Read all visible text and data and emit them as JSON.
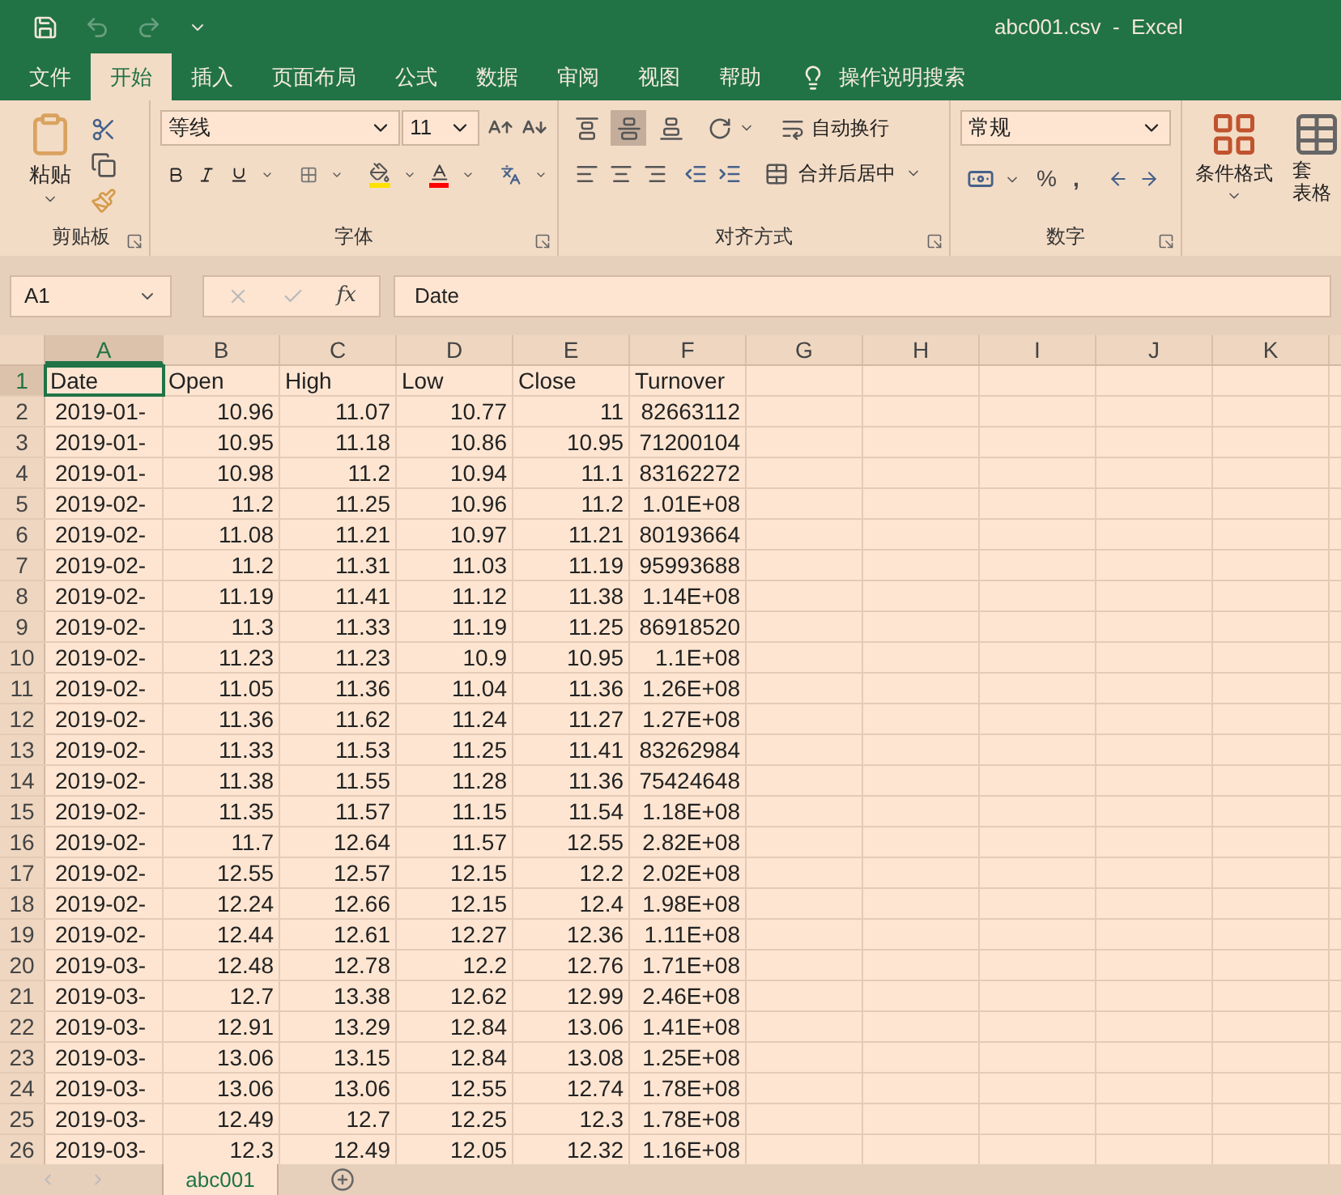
{
  "window": {
    "title": "abc001.csv  -  Excel"
  },
  "menu_tabs": [
    {
      "label": "文件",
      "selected": false
    },
    {
      "label": "开始",
      "selected": true
    },
    {
      "label": "插入",
      "selected": false
    },
    {
      "label": "页面布局",
      "selected": false
    },
    {
      "label": "公式",
      "selected": false
    },
    {
      "label": "数据",
      "selected": false
    },
    {
      "label": "审阅",
      "selected": false
    },
    {
      "label": "视图",
      "selected": false
    },
    {
      "label": "帮助",
      "selected": false
    }
  ],
  "tell_me": {
    "placeholder": "操作说明搜索"
  },
  "ribbon": {
    "clipboard": {
      "label": "剪贴板",
      "paste": "粘贴"
    },
    "font": {
      "label": "字体",
      "font_name": "等线",
      "font_size": "11"
    },
    "alignment": {
      "label": "对齐方式",
      "vertical": [
        {
          "kind": "top",
          "selected": false
        },
        {
          "kind": "middle",
          "selected": true
        },
        {
          "kind": "bottom",
          "selected": false
        }
      ],
      "wrap": "自动换行",
      "merge": "合并后居中"
    },
    "number": {
      "label": "数字",
      "format": "常规",
      "percent": "%",
      "comma": ","
    },
    "styles": {
      "conditional": "条件格式",
      "table_top": "套",
      "table_bottom": "表格"
    }
  },
  "formula_bar": {
    "name_box": "A1",
    "fx": "fx",
    "value": "Date"
  },
  "columns": [
    {
      "label": "A",
      "selected": true
    },
    {
      "label": "B",
      "selected": false
    },
    {
      "label": "C",
      "selected": false
    },
    {
      "label": "D",
      "selected": false
    },
    {
      "label": "E",
      "selected": false
    },
    {
      "label": "F",
      "selected": false
    },
    {
      "label": "G",
      "selected": false
    },
    {
      "label": "H",
      "selected": false
    },
    {
      "label": "I",
      "selected": false
    },
    {
      "label": "J",
      "selected": false
    },
    {
      "label": "K",
      "selected": false
    }
  ],
  "rows": [
    {
      "n": "1",
      "selected": true,
      "cells": [
        "Date",
        "Open",
        "High",
        "Low",
        "Close",
        "Turnover"
      ]
    },
    {
      "n": "2",
      "selected": false,
      "cells": [
        "2019-01-",
        "10.96",
        "11.07",
        "10.77",
        "11",
        "82663112"
      ]
    },
    {
      "n": "3",
      "selected": false,
      "cells": [
        "2019-01-",
        "10.95",
        "11.18",
        "10.86",
        "10.95",
        "71200104"
      ]
    },
    {
      "n": "4",
      "selected": false,
      "cells": [
        "2019-01-",
        "10.98",
        "11.2",
        "10.94",
        "11.1",
        "83162272"
      ]
    },
    {
      "n": "5",
      "selected": false,
      "cells": [
        "2019-02-",
        "11.2",
        "11.25",
        "10.96",
        "11.2",
        "1.01E+08"
      ]
    },
    {
      "n": "6",
      "selected": false,
      "cells": [
        "2019-02-",
        "11.08",
        "11.21",
        "10.97",
        "11.21",
        "80193664"
      ]
    },
    {
      "n": "7",
      "selected": false,
      "cells": [
        "2019-02-",
        "11.2",
        "11.31",
        "11.03",
        "11.19",
        "95993688"
      ]
    },
    {
      "n": "8",
      "selected": false,
      "cells": [
        "2019-02-",
        "11.19",
        "11.41",
        "11.12",
        "11.38",
        "1.14E+08"
      ]
    },
    {
      "n": "9",
      "selected": false,
      "cells": [
        "2019-02-",
        "11.3",
        "11.33",
        "11.19",
        "11.25",
        "86918520"
      ]
    },
    {
      "n": "10",
      "selected": false,
      "cells": [
        "2019-02-",
        "11.23",
        "11.23",
        "10.9",
        "10.95",
        "1.1E+08"
      ]
    },
    {
      "n": "11",
      "selected": false,
      "cells": [
        "2019-02-",
        "11.05",
        "11.36",
        "11.04",
        "11.36",
        "1.26E+08"
      ]
    },
    {
      "n": "12",
      "selected": false,
      "cells": [
        "2019-02-",
        "11.36",
        "11.62",
        "11.24",
        "11.27",
        "1.27E+08"
      ]
    },
    {
      "n": "13",
      "selected": false,
      "cells": [
        "2019-02-",
        "11.33",
        "11.53",
        "11.25",
        "11.41",
        "83262984"
      ]
    },
    {
      "n": "14",
      "selected": false,
      "cells": [
        "2019-02-",
        "11.38",
        "11.55",
        "11.28",
        "11.36",
        "75424648"
      ]
    },
    {
      "n": "15",
      "selected": false,
      "cells": [
        "2019-02-",
        "11.35",
        "11.57",
        "11.15",
        "11.54",
        "1.18E+08"
      ]
    },
    {
      "n": "16",
      "selected": false,
      "cells": [
        "2019-02-",
        "11.7",
        "12.64",
        "11.57",
        "12.55",
        "2.82E+08"
      ]
    },
    {
      "n": "17",
      "selected": false,
      "cells": [
        "2019-02-",
        "12.55",
        "12.57",
        "12.15",
        "12.2",
        "2.02E+08"
      ]
    },
    {
      "n": "18",
      "selected": false,
      "cells": [
        "2019-02-",
        "12.24",
        "12.66",
        "12.15",
        "12.4",
        "1.98E+08"
      ]
    },
    {
      "n": "19",
      "selected": false,
      "cells": [
        "2019-02-",
        "12.44",
        "12.61",
        "12.27",
        "12.36",
        "1.11E+08"
      ]
    },
    {
      "n": "20",
      "selected": false,
      "cells": [
        "2019-03-",
        "12.48",
        "12.78",
        "12.2",
        "12.76",
        "1.71E+08"
      ]
    },
    {
      "n": "21",
      "selected": false,
      "cells": [
        "2019-03-",
        "12.7",
        "13.38",
        "12.62",
        "12.99",
        "2.46E+08"
      ]
    },
    {
      "n": "22",
      "selected": false,
      "cells": [
        "2019-03-",
        "12.91",
        "13.29",
        "12.84",
        "13.06",
        "1.41E+08"
      ]
    },
    {
      "n": "23",
      "selected": false,
      "cells": [
        "2019-03-",
        "13.06",
        "13.15",
        "12.84",
        "13.08",
        "1.25E+08"
      ]
    },
    {
      "n": "24",
      "selected": false,
      "cells": [
        "2019-03-",
        "13.06",
        "13.06",
        "12.55",
        "12.74",
        "1.78E+08"
      ]
    },
    {
      "n": "25",
      "selected": false,
      "cells": [
        "2019-03-",
        "12.49",
        "12.7",
        "12.25",
        "12.3",
        "1.78E+08"
      ]
    },
    {
      "n": "26",
      "selected": false,
      "cells": [
        "2019-03-",
        "12.3",
        "12.49",
        "12.05",
        "12.32",
        "1.16E+08"
      ]
    }
  ],
  "sheets": [
    {
      "label": "abc001",
      "selected": true
    }
  ]
}
